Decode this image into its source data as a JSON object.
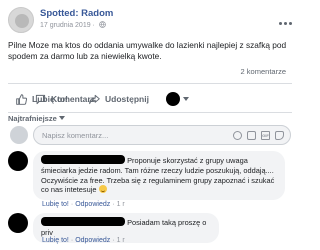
{
  "post": {
    "page_name": "Spotted: Radom",
    "date": "17 grudnia 2019 ·",
    "text": "Pilne Moze ma ktos do oddania umywalke do lazienki najlepiej z szafką pod spodem za darmo lub za niewielką kwote.",
    "comment_count": "2 komentarze"
  },
  "actions": {
    "like": "Lubię to!",
    "comment": "Komentarz",
    "share": "Udostępnij"
  },
  "sort_label": "Najtrafniejsze",
  "composer": {
    "placeholder": "Napisz komentarz..."
  },
  "comments": [
    {
      "text_first": "Proponuje skorzystać z grupy uwaga śmieciarka jedzie radom. Tam różne rzeczy ludzie poszukują, oddają.... Oczywiście za free. Trzeba się z regulaminem grupy zapoznać i szukać co nas intetesuje",
      "like_link": "Lubię to!",
      "reply_link": "Odpowiedz",
      "age": "1 r"
    },
    {
      "text_first": "Posiadam taką proszę o priv",
      "like_link": "Lubię to!",
      "reply_link": "Odpowiedz",
      "age": "1 r"
    }
  ],
  "colors": {
    "link": "#385898",
    "secondary_text": "#606770",
    "bubble": "#f2f3f5",
    "divider": "#dadde1"
  }
}
